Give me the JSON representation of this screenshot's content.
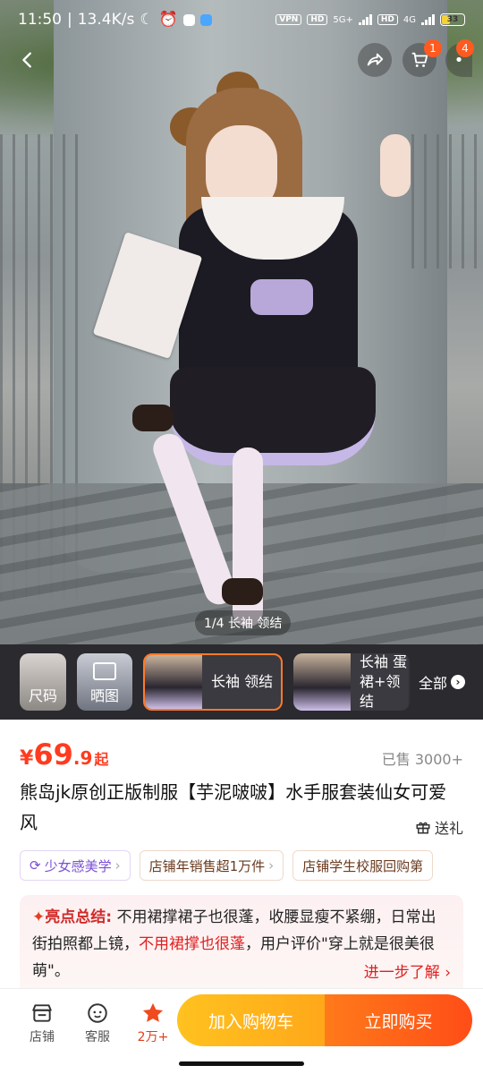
{
  "status_bar": {
    "time": "11:50",
    "speed": "13.4K/s",
    "vpn": "VPN",
    "hd1": "HD",
    "net1": "5G+",
    "hd2": "HD",
    "net2": "4G",
    "battery": "33"
  },
  "nav": {
    "cart_badge": "1",
    "more_badge": "4"
  },
  "gallery": {
    "counter": "1/4 长袖 领结",
    "thumbs": [
      {
        "label": "尺码"
      },
      {
        "label": "晒图"
      },
      {
        "label": "长袖 领结"
      },
      {
        "label": "长袖 蛋\n裙+领结"
      }
    ],
    "all_label": "全部"
  },
  "product": {
    "price_currency": "¥",
    "price_int": "69",
    "price_dec": ".9",
    "price_suffix": "起",
    "sold": "已售 3000+",
    "title": "熊岛jk原创正版制服【芋泥啵啵】水手服套装仙女可爱风",
    "gift_label": "送礼",
    "tags": [
      {
        "label": "少女感美学"
      },
      {
        "label": "店铺年销售超1万件"
      },
      {
        "label": "店铺学生校服回购第"
      }
    ]
  },
  "highlight": {
    "title": "亮点总结:",
    "text1": " 不用裙撑裙子也很蓬，收腰显瘦不紧绷，日常出街拍照都上镜，",
    "emph": "不用裙撑也很蓬",
    "text2": "，用户评价\"穿上就是很美很萌\"。",
    "more": "进一步了解"
  },
  "bottom_bar": {
    "shop": "店铺",
    "service": "客服",
    "fav_count": "2万+",
    "add_cart": "加入购物车",
    "buy_now": "立即购买"
  },
  "colors": {
    "price": "#ff3b1f",
    "accent_orange": "#ff7a2a",
    "cart_yellow": "#ffb21f",
    "buy_orange": "#ff5a17"
  }
}
